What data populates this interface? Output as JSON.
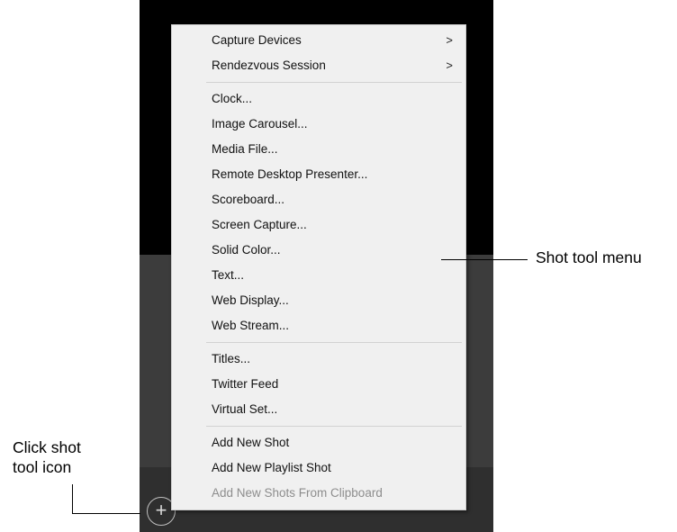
{
  "menu": {
    "groups": [
      [
        {
          "label": "Capture Devices",
          "submenu": true
        },
        {
          "label": "Rendezvous Session",
          "submenu": true
        }
      ],
      [
        {
          "label": "Clock..."
        },
        {
          "label": "Image Carousel..."
        },
        {
          "label": "Media File..."
        },
        {
          "label": "Remote Desktop Presenter..."
        },
        {
          "label": "Scoreboard..."
        },
        {
          "label": "Screen Capture..."
        },
        {
          "label": "Solid Color..."
        },
        {
          "label": "Text..."
        },
        {
          "label": "Web Display..."
        },
        {
          "label": "Web Stream..."
        }
      ],
      [
        {
          "label": "Titles..."
        },
        {
          "label": "Twitter Feed"
        },
        {
          "label": "Virtual Set..."
        }
      ],
      [
        {
          "label": "Add New Shot"
        },
        {
          "label": "Add New Playlist Shot"
        },
        {
          "label": "Add New Shots From Clipboard",
          "disabled": true
        }
      ]
    ],
    "submenu_arrow": ">"
  },
  "annotations": {
    "menu_callout": "Shot tool menu",
    "icon_callout_line1": "Click shot",
    "icon_callout_line2": "tool icon"
  },
  "shot_tool_button": {
    "icon": "plus-circle-icon",
    "glyph": "+"
  }
}
